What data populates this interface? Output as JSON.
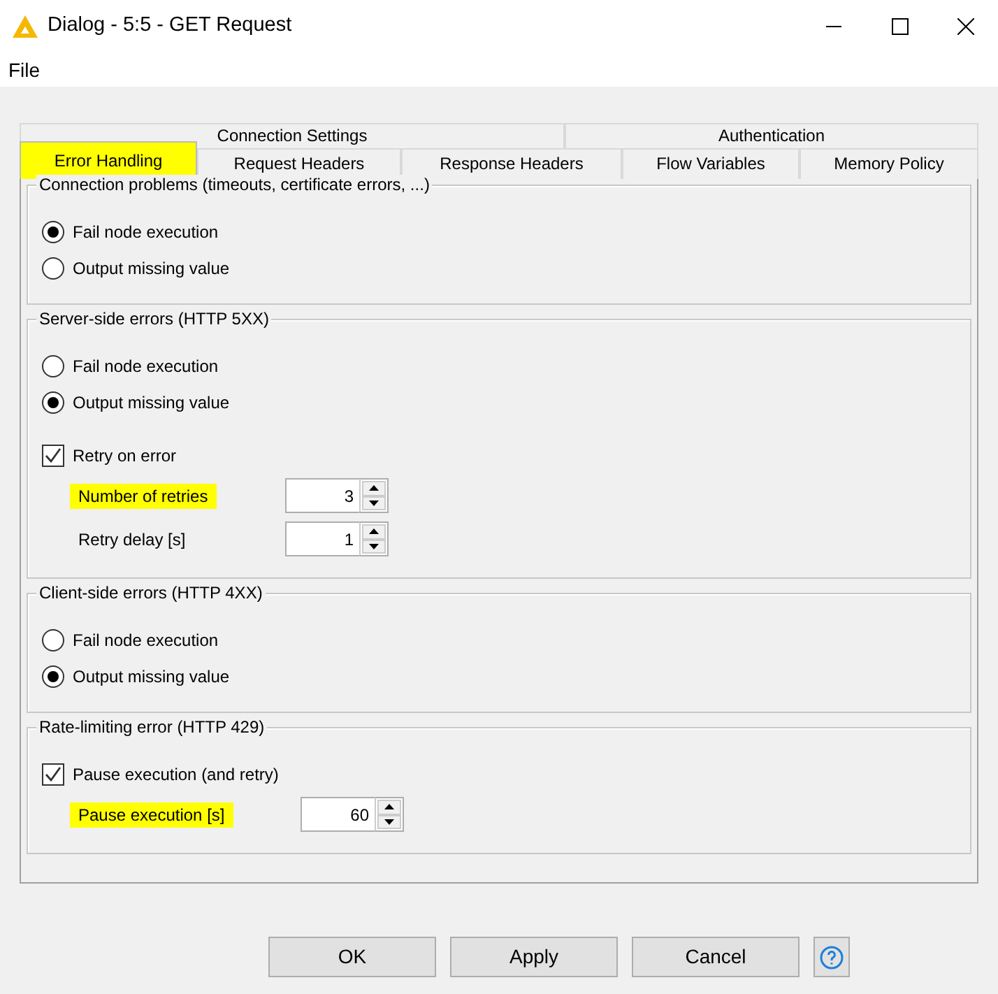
{
  "window": {
    "title": "Dialog - 5:5 - GET Request"
  },
  "menu": [
    "File"
  ],
  "tab_rows": [
    [
      {
        "label": "Connection Settings",
        "selected": false,
        "highlighted": false
      },
      {
        "label": "Authentication",
        "selected": false,
        "highlighted": false
      }
    ],
    [
      {
        "label": "Error Handling",
        "selected": true,
        "highlighted": true
      },
      {
        "label": "Request Headers",
        "selected": false,
        "highlighted": false
      },
      {
        "label": "Response Headers",
        "selected": false,
        "highlighted": false
      },
      {
        "label": "Flow Variables",
        "selected": false,
        "highlighted": false
      },
      {
        "label": "Memory Policy",
        "selected": false,
        "highlighted": false
      }
    ]
  ],
  "groups": [
    {
      "title": "Connection problems (timeouts, certificate errors, ...)",
      "items": [
        {
          "kind": "radio",
          "label": "Fail node execution",
          "selected": true
        },
        {
          "kind": "radio",
          "label": "Output missing value",
          "selected": false
        }
      ]
    },
    {
      "title": "Server-side errors (HTTP 5XX)",
      "items": [
        {
          "kind": "radio",
          "label": "Fail node execution",
          "selected": false
        },
        {
          "kind": "radio",
          "label": "Output missing value",
          "selected": true
        },
        {
          "kind": "checkbox",
          "label": "Retry on error",
          "checked": true
        },
        {
          "kind": "spinner",
          "label": "Number of retries",
          "value": "3",
          "highlighted": true
        },
        {
          "kind": "spinner",
          "label": "Retry delay [s]",
          "value": "1",
          "highlighted": false
        }
      ]
    },
    {
      "title": "Client-side errors (HTTP 4XX)",
      "items": [
        {
          "kind": "radio",
          "label": "Fail node execution",
          "selected": false
        },
        {
          "kind": "radio",
          "label": "Output missing value",
          "selected": true
        }
      ]
    },
    {
      "title": "Rate-limiting error (HTTP 429)",
      "items": [
        {
          "kind": "checkbox",
          "label": "Pause execution (and retry)",
          "checked": true
        },
        {
          "kind": "spinner",
          "label": "Pause execution [s]",
          "value": "60",
          "highlighted": true
        }
      ]
    }
  ],
  "buttons": [
    "OK",
    "Apply",
    "Cancel"
  ]
}
